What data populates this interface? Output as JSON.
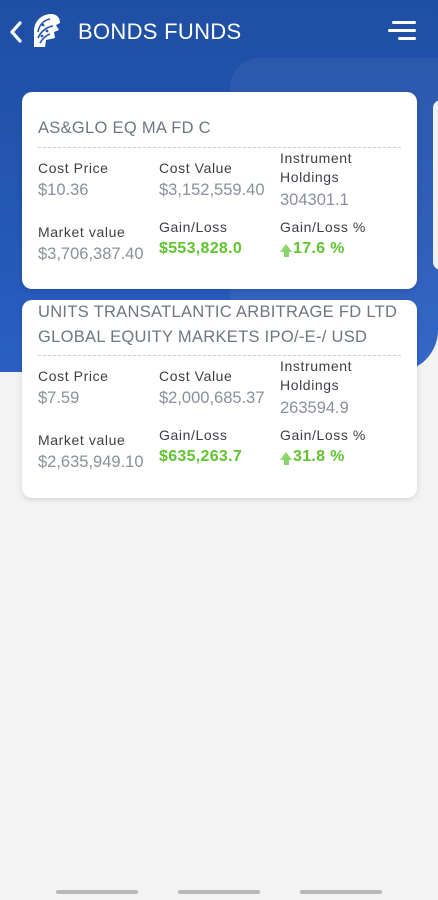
{
  "header": {
    "title": "BONDS FUNDS",
    "colors": {
      "primary": "#2354ae",
      "gain": "#5fc42f"
    }
  },
  "labels": {
    "cost_price": "Cost Price",
    "cost_value": "Cost Value",
    "instrument_holdings": "Instrument Holdings",
    "market_value": "Market value",
    "gain_loss": "Gain/Loss",
    "gain_loss_pct": "Gain/Loss %"
  },
  "funds": [
    {
      "name": "AS&GLO EQ MA FD C",
      "cost_price": "$10.36",
      "cost_value": "$3,152,559.40",
      "holdings": "304301.1",
      "market_value": "$3,706,387.40",
      "gain_loss": "$553,828.0",
      "gain_loss_pct": "17.6 %"
    },
    {
      "name": "UNITS TRANSATLANTIC ARBITRAGE FD LTD GLOBAL EQUITY MARKETS IPO/-E-/ USD",
      "cost_price": "$7.59",
      "cost_value": "$2,000,685.37",
      "holdings": "263594.9",
      "market_value": "$2,635,949.10",
      "gain_loss": "$635,263.7",
      "gain_loss_pct": "31.8 %"
    }
  ]
}
